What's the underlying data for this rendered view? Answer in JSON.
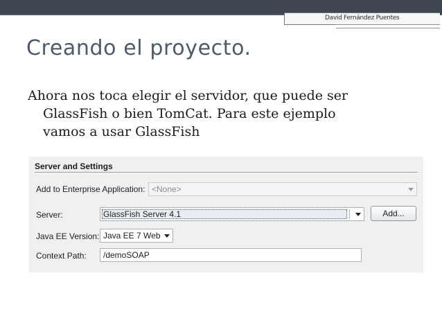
{
  "slide": {
    "author": "David Fernández Puentes",
    "title": "Creando el proyecto.",
    "body_lines": [
      "Ahora nos toca elegir el servidor, que puede ser",
      "GlassFish o bien TomCat. Para este ejemplo",
      "vamos a usar GlassFish"
    ]
  },
  "dialog": {
    "section_title": "Server and Settings",
    "enterprise_label": "Add to Enterprise Application:",
    "enterprise_value": "<None>",
    "server_label": "Server:",
    "server_value": "GlassFish Server 4.1",
    "add_button": "Add...",
    "javaee_label": "Java EE Version:",
    "javaee_value": "Java EE 7 Web",
    "context_label": "Context Path:",
    "context_value": "/demoSOAP"
  },
  "colors": {
    "topbar": "#3f4650",
    "title": "#4d5a67",
    "dialog_bg": "#f0f0f0"
  }
}
